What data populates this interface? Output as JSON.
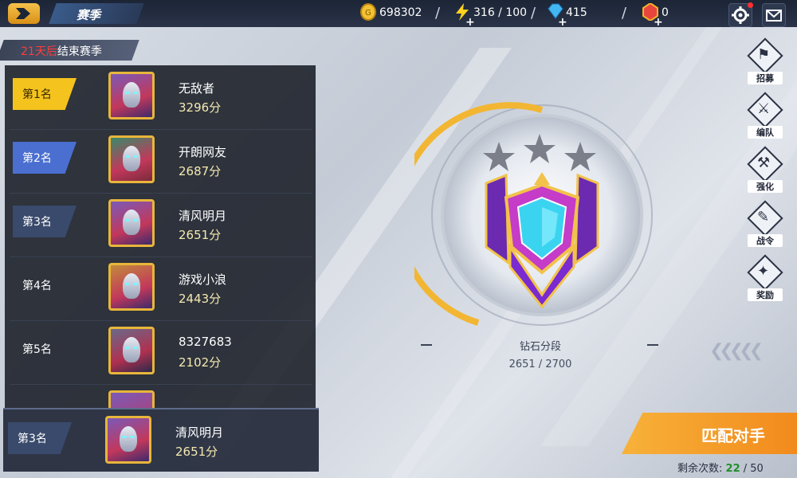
{
  "header": {
    "title": "赛季",
    "gold": "698302",
    "energy": "316 / 100",
    "gems": "415",
    "crystals": "0"
  },
  "season": {
    "days_left": "21天后",
    "suffix": "结束赛季"
  },
  "ranking": [
    {
      "rank": "第1名",
      "name": "无敌者",
      "score": "3296分",
      "badge_color": "#f4c31e"
    },
    {
      "rank": "第2名",
      "name": "开朗网友",
      "score": "2687分",
      "badge_color": "#4a6fd0"
    },
    {
      "rank": "第3名",
      "name": "清风明月",
      "score": "2651分",
      "badge_color": "#3a4a6c"
    },
    {
      "rank": "第4名",
      "name": "游戏小浪",
      "score": "2443分",
      "badge_color": "transparent"
    },
    {
      "rank": "第5名",
      "name": "8327683",
      "score": "2102分",
      "badge_color": "transparent"
    }
  ],
  "my_rank": {
    "rank": "第3名",
    "name": "清风明月",
    "score": "2651分"
  },
  "tier": {
    "name": "钻石分段",
    "progress": "2651 / 2700",
    "stars_filled": 0,
    "stars_total": 3,
    "fraction": 0.982
  },
  "side_menu": [
    {
      "label": "招募",
      "icon": "banner-icon"
    },
    {
      "label": "编队",
      "icon": "swords-icon"
    },
    {
      "label": "强化",
      "icon": "upgrade-icon"
    },
    {
      "label": "战令",
      "icon": "pass-icon"
    },
    {
      "label": "奖励",
      "icon": "gift-icon"
    }
  ],
  "match": {
    "label": "匹配对手",
    "remain_label": "剩余次数:",
    "remain_used": "22",
    "remain_total": "/ 50"
  },
  "colors": {
    "accent": "#f28a1c",
    "gold": "#e8b63a",
    "panel": "#181c26"
  }
}
